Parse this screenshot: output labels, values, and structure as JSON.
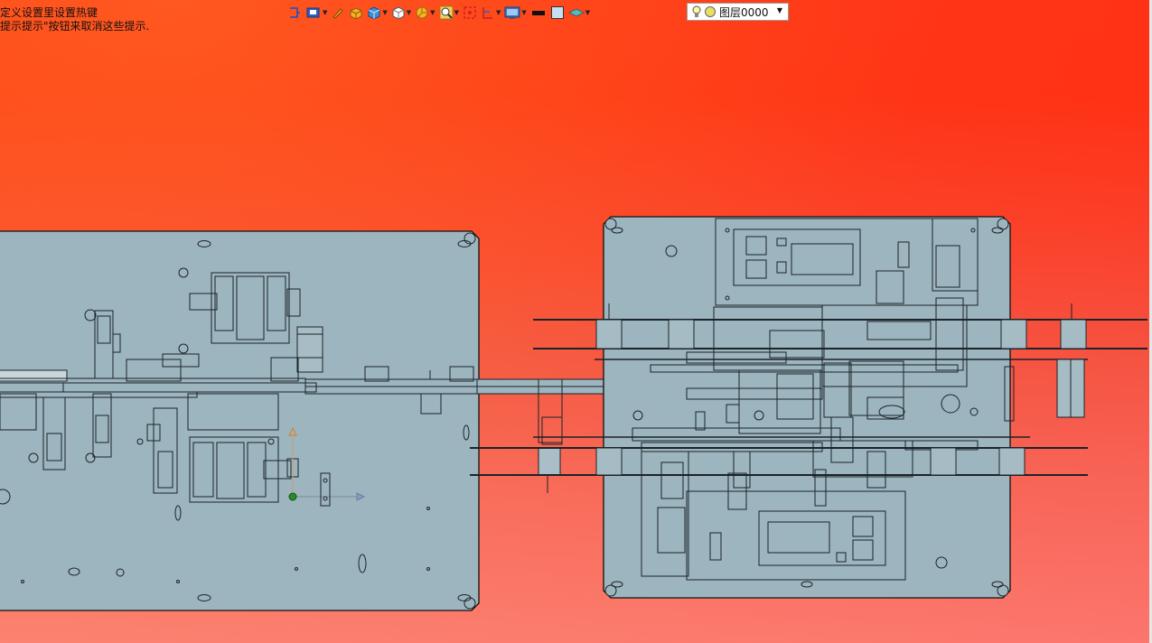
{
  "hints": {
    "line1": "定义设置里设置热键",
    "line2": "提示提示\"按钮来取消这些提示."
  },
  "toolbar": {
    "tools": [
      {
        "name": "view-cube-icon",
        "dropdown": false
      },
      {
        "name": "render-style-icon",
        "dropdown": true
      },
      {
        "name": "pen-icon",
        "dropdown": false
      },
      {
        "name": "solid-icon",
        "dropdown": false
      },
      {
        "name": "box-blue-icon",
        "dropdown": true
      },
      {
        "name": "box-white-icon",
        "dropdown": true
      },
      {
        "name": "pie-icon",
        "dropdown": true
      },
      {
        "name": "zoom-icon",
        "dropdown": true
      },
      {
        "name": "select-red-icon",
        "dropdown": false
      },
      {
        "name": "section-icon",
        "dropdown": true
      },
      {
        "name": "display-icon",
        "dropdown": true
      },
      {
        "name": "line-black-icon",
        "dropdown": false
      },
      {
        "name": "fill-square-icon",
        "dropdown": false
      },
      {
        "name": "plane-icon",
        "dropdown": true
      }
    ],
    "layer_selector": {
      "value": "图层0000",
      "icons": [
        "bulb-icon",
        "sun-icon"
      ]
    }
  },
  "colors": {
    "background_top": "#ff3a18",
    "background_bottom": "#fb8a80",
    "plate_fill": "#9eb6c0",
    "line": "#1a2226"
  }
}
